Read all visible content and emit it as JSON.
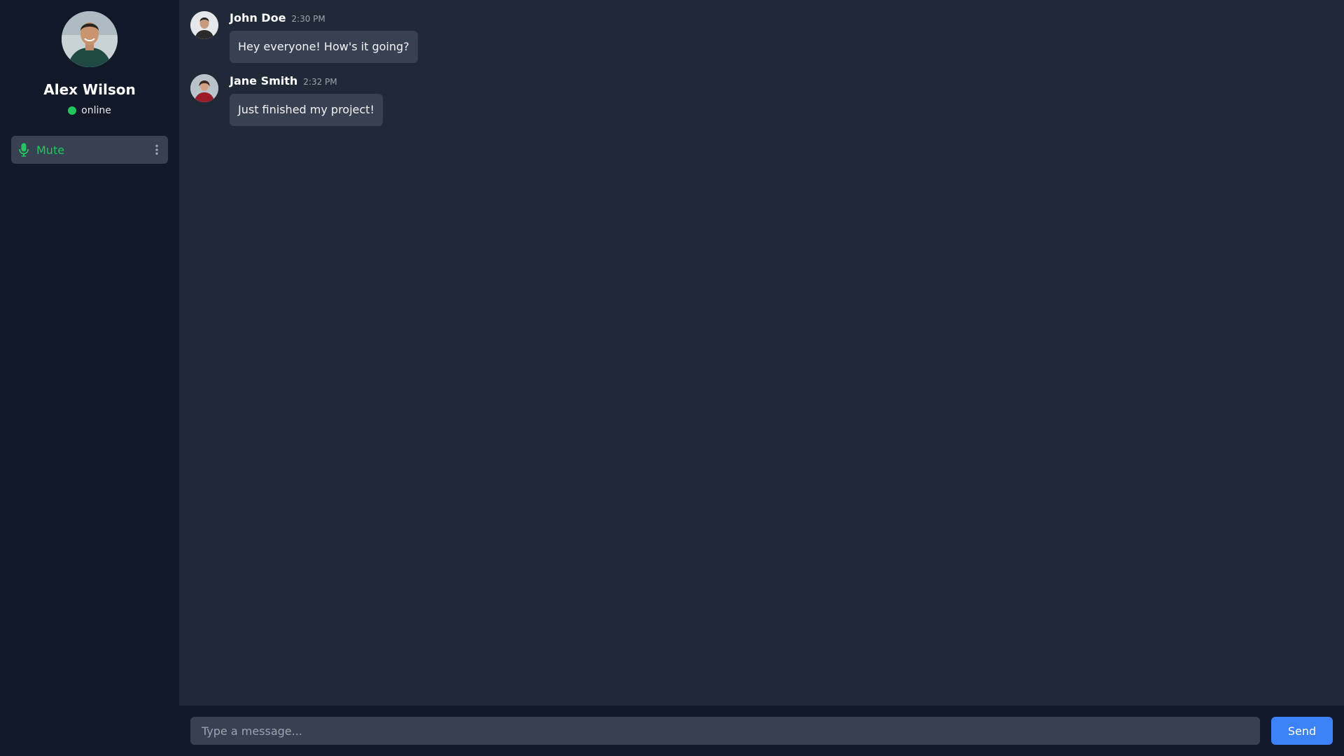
{
  "colors": {
    "sidebar_bg": "#111827",
    "main_bg": "#1f2937",
    "bubble_bg": "#374151",
    "status_online": "#22c55e",
    "send_button": "#3b82f6"
  },
  "sidebar": {
    "user": {
      "name": "Alex Wilson",
      "status": "online",
      "avatar_icon": "user-photo"
    },
    "voice": {
      "label": "Mute",
      "icon": "microphone-icon",
      "menu_icon": "more-vertical-icon"
    }
  },
  "messages": [
    {
      "author": "John Doe",
      "time": "2:30 PM",
      "text": "Hey everyone! How's it going?"
    },
    {
      "author": "Jane Smith",
      "time": "2:32 PM",
      "text": "Just finished my project!"
    }
  ],
  "composer": {
    "placeholder": "Type a message...",
    "value": "",
    "send_label": "Send"
  }
}
